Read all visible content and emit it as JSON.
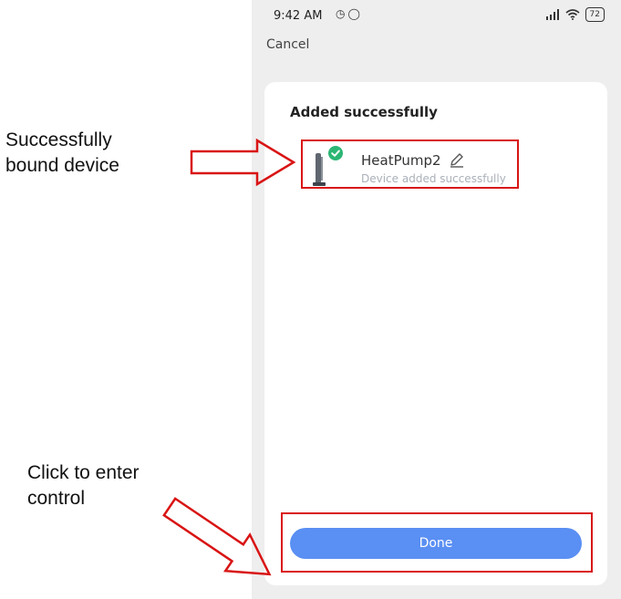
{
  "annotations": {
    "bound_device_text": "Successfully\nbound device",
    "click_text": "Click to enter\ncontrol"
  },
  "status_bar": {
    "time": "9:42 AM",
    "left_icons": [
      "alarm-icon",
      "chat-icon"
    ],
    "right_icons": [
      "signal-icon",
      "wifi-icon"
    ],
    "battery": "72"
  },
  "header": {
    "cancel_label": "Cancel"
  },
  "card": {
    "title": "Added successfully",
    "device": {
      "name": "HeatPump2",
      "status": "Device added successfully"
    },
    "done_label": "Done"
  },
  "colors": {
    "highlight": "#d91414",
    "accent": "#5a8ff3",
    "check_badge": "#2bb673"
  }
}
